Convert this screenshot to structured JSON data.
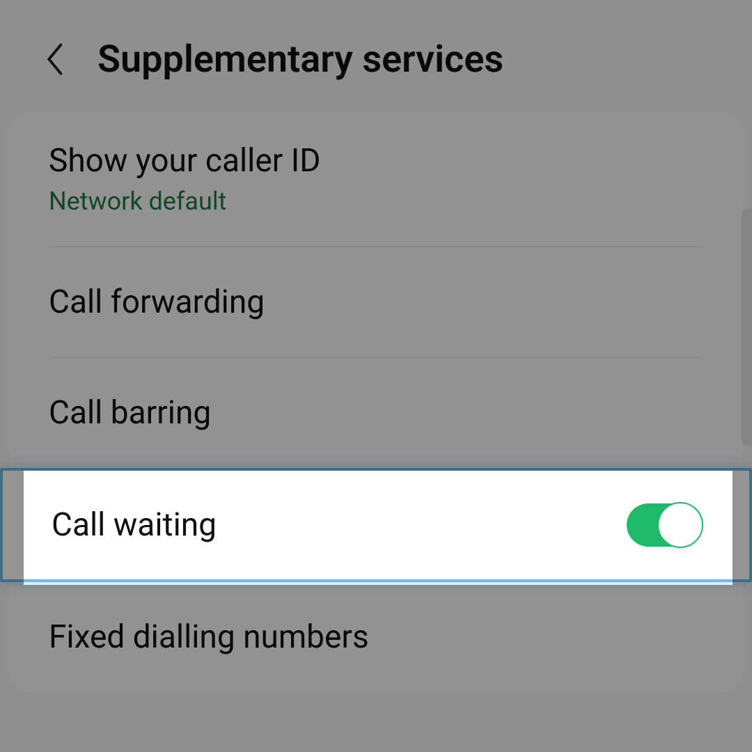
{
  "header": {
    "title": "Supplementary services"
  },
  "items": {
    "caller_id": {
      "title": "Show your caller ID",
      "subtitle": "Network default"
    },
    "call_forwarding": {
      "title": "Call forwarding"
    },
    "call_barring": {
      "title": "Call barring"
    },
    "call_waiting": {
      "title": "Call waiting",
      "toggle_on": true
    },
    "fixed_dialling": {
      "title": "Fixed dialling numbers"
    }
  },
  "colors": {
    "accent_toggle": "#1fb96a",
    "subtitle_green": "#1f7a4a",
    "highlight_border": "#6fb9e6"
  }
}
